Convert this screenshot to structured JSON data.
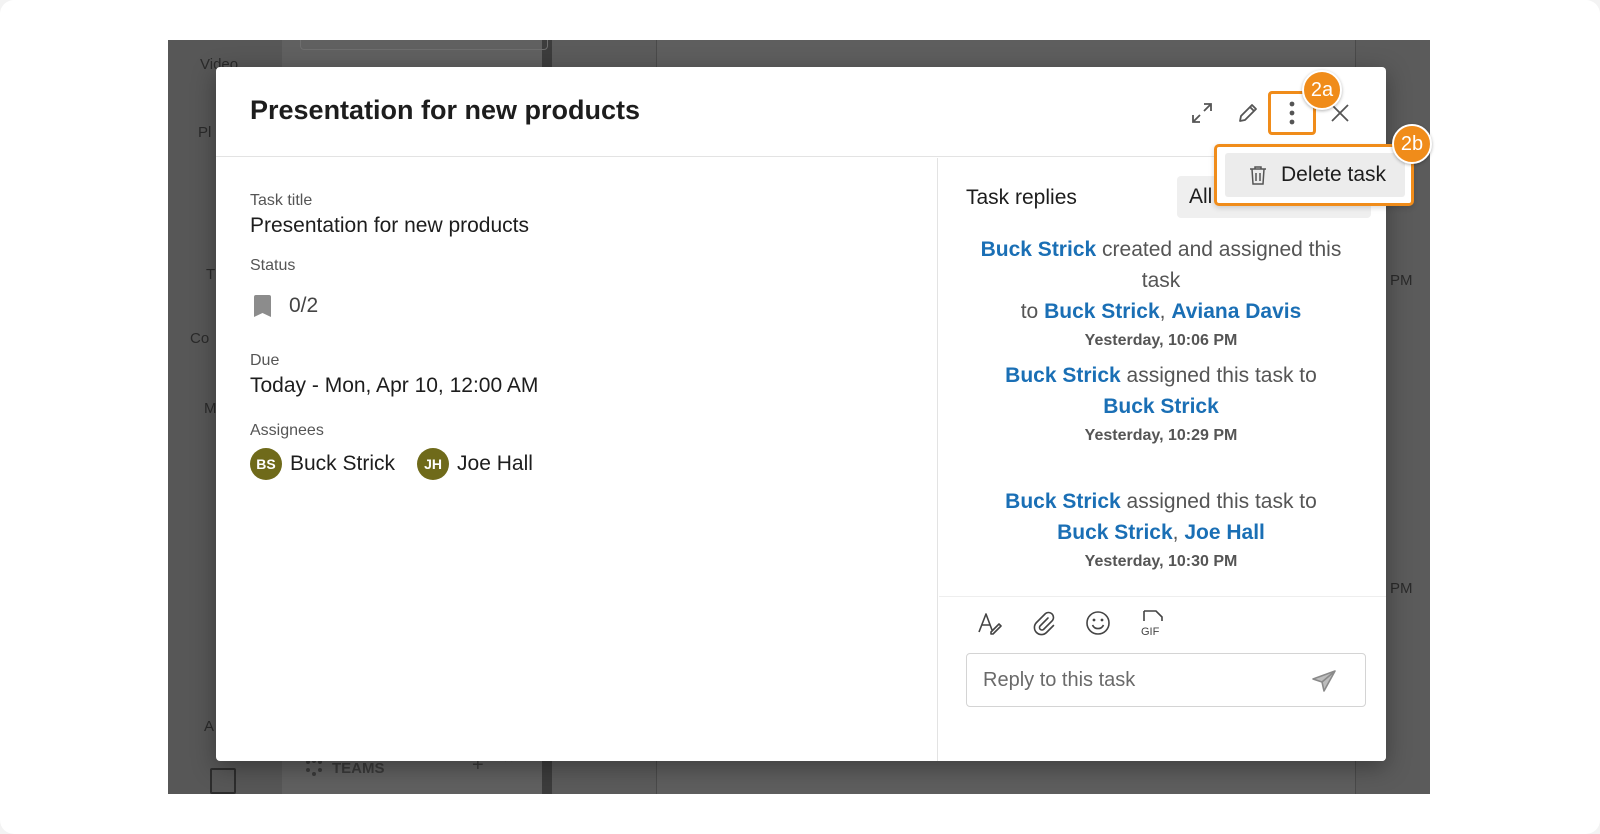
{
  "background_app": {
    "rail_labels": [
      "Video",
      "Pl",
      "T",
      "T",
      "Co",
      "M",
      "A"
    ],
    "teams_label": "TEAMS",
    "right_time_fragments": [
      "PM",
      "PM"
    ]
  },
  "modal": {
    "title": "Presentation for new products",
    "header_buttons": [
      "expand-icon",
      "pencil-icon",
      "vertical-dots-icon",
      "close-icon"
    ]
  },
  "details": {
    "task_title_label": "Task title",
    "task_title_value": "Presentation for new products",
    "status_label": "Status",
    "status_value": "0/2",
    "due_label": "Due",
    "due_value": "Today - Mon, Apr 10, 12:00 AM",
    "assignees_label": "Assignees",
    "assignees": [
      {
        "initials": "BS",
        "name": "Buck Strick"
      },
      {
        "initials": "JH",
        "name": "Joe Hall"
      }
    ]
  },
  "replies": {
    "title": "Task replies",
    "filter_value": "All",
    "activity": [
      {
        "actor": "Buck Strick",
        "text1": " created and assigned this task",
        "text2": "to ",
        "targets": [
          "Buck Strick",
          "Aviana Davis"
        ],
        "time": "Yesterday, 10:06 PM"
      },
      {
        "actor": "Buck Strick",
        "text1": " assigned this task to",
        "text2": "",
        "targets": [
          "Buck Strick"
        ],
        "time": "Yesterday, 10:29 PM"
      },
      {
        "actor": "Buck Strick",
        "text1": " assigned this task to",
        "text2": "",
        "targets": [
          "Buck Strick",
          "Joe Hall"
        ],
        "time": "Yesterday, 10:30 PM"
      }
    ],
    "composer": {
      "tools": [
        "format-text-icon",
        "paperclip-icon",
        "emoji-icon",
        "gif-icon"
      ],
      "gif_label": "GIF",
      "placeholder": "Reply to this task"
    }
  },
  "menu": {
    "delete_label": "Delete task"
  },
  "callouts": {
    "a": "2a",
    "b": "2b"
  },
  "colors": {
    "accent_orange": "#f08c1a",
    "link_blue": "#1a6fb5",
    "avatar_olive": "#6f6a1a"
  }
}
